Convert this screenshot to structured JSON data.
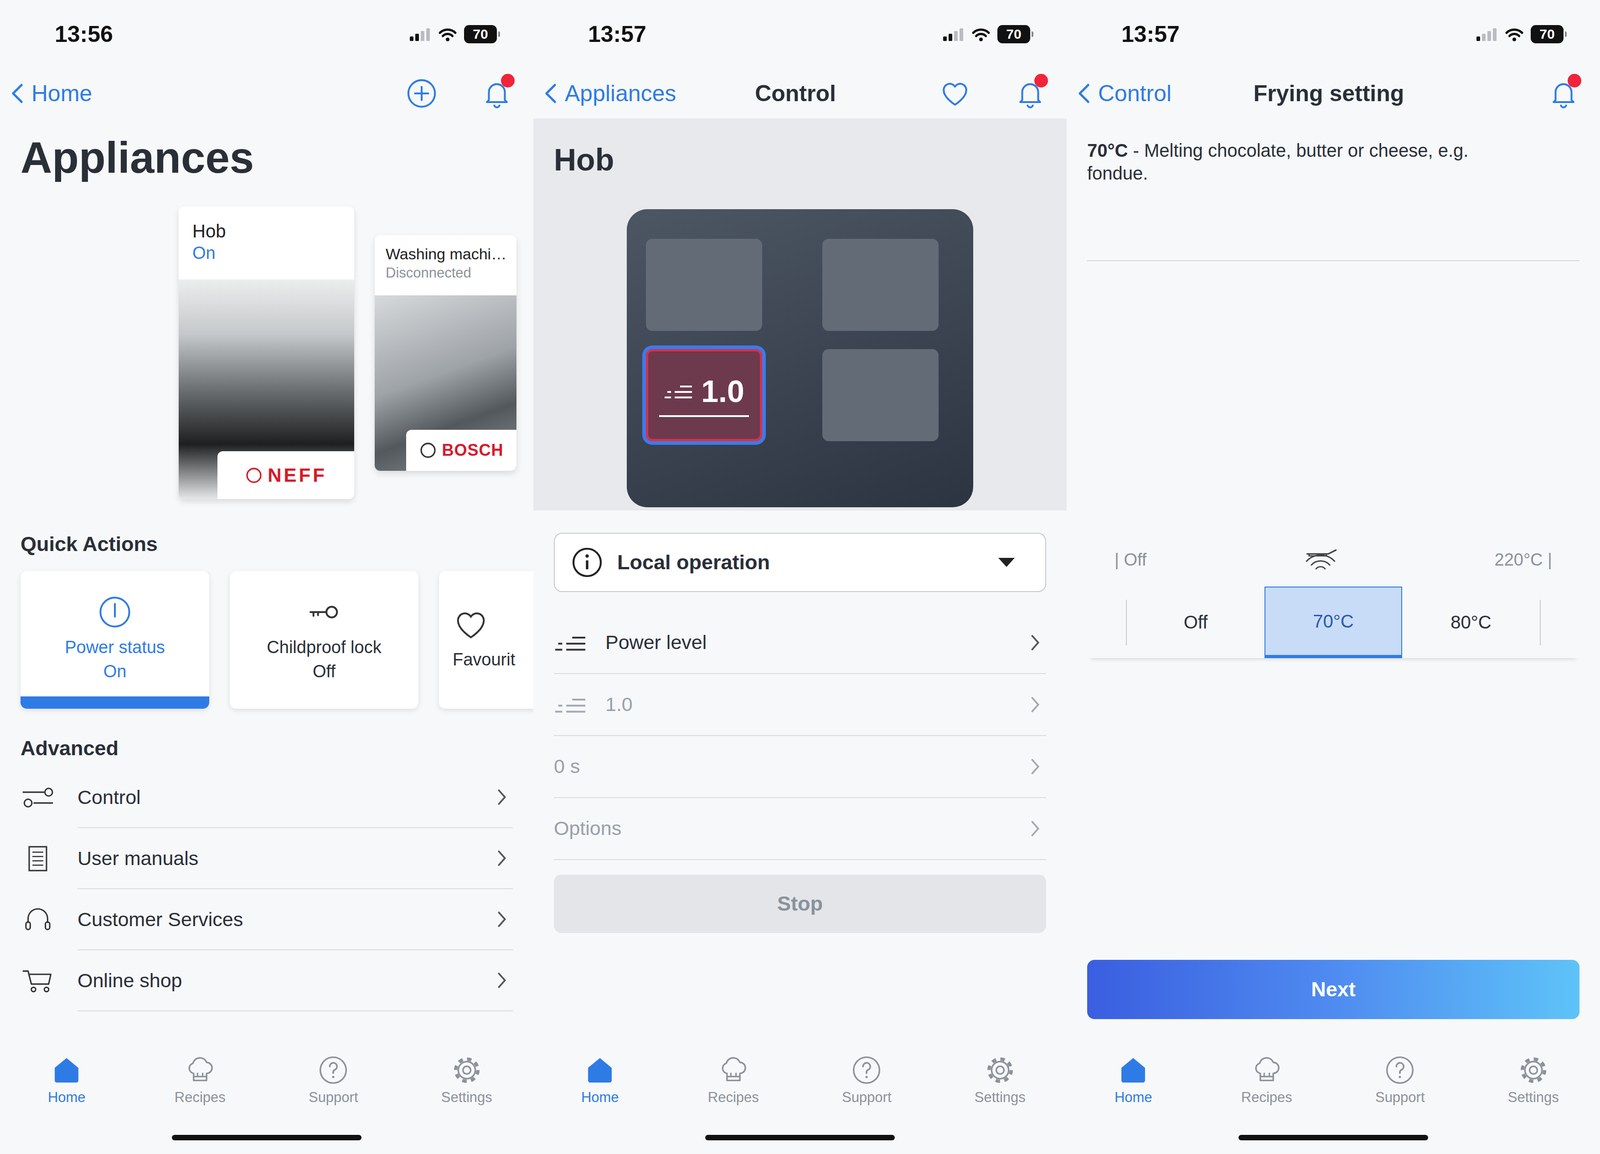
{
  "tab_bar": [
    {
      "label": "Home",
      "selected": true
    },
    {
      "label": "Recipes",
      "selected": false
    },
    {
      "label": "Support",
      "selected": false
    },
    {
      "label": "Settings",
      "selected": false
    }
  ],
  "screens": [
    {
      "kind": "appliances",
      "status_bar": {
        "time": "13:56",
        "battery": "70",
        "signal_bars": 2
      },
      "nav": {
        "back": "Home",
        "title": "",
        "notification": true
      },
      "title": "Appliances",
      "appliances": [
        {
          "name": "Hob",
          "status": "On",
          "brand": "NEFF",
          "connected": true,
          "selected": true
        },
        {
          "name": "Washing machi…",
          "status": "Disconnected",
          "brand": "BOSCH",
          "connected": false,
          "selected": false
        }
      ],
      "quick_actions": {
        "title": "Quick Actions",
        "items": [
          {
            "label": "Power status",
            "value": "On",
            "selected": true
          },
          {
            "label": "Childproof lock",
            "value": "Off",
            "selected": false
          },
          {
            "label": "Favourit",
            "value": "",
            "selected": false
          }
        ]
      },
      "advanced": {
        "title": "Advanced",
        "items": [
          "Control",
          "User manuals",
          "Customer Services",
          "Online shop"
        ]
      }
    },
    {
      "kind": "control",
      "status_bar": {
        "time": "13:57",
        "battery": "70",
        "signal_bars": 2
      },
      "nav": {
        "back": "Appliances",
        "title": "Control",
        "notification": true
      },
      "panel_title": "Hob",
      "zones": [
        {
          "selected": false,
          "level": ""
        },
        {
          "selected": false,
          "level": ""
        },
        {
          "selected": true,
          "level": "1.0"
        },
        {
          "selected": false,
          "level": ""
        }
      ],
      "dropdown": {
        "label": "Local operation",
        "expanded": false
      },
      "rows": [
        {
          "kind": "level",
          "label": "Power level",
          "disabled": false
        },
        {
          "kind": "level",
          "label": "1.0",
          "disabled": true
        },
        {
          "kind": "plain",
          "label": "0 s",
          "disabled": true
        },
        {
          "kind": "plain",
          "label": "Options",
          "disabled": true
        }
      ],
      "button": {
        "label": "Stop",
        "disabled": true
      }
    },
    {
      "kind": "frying",
      "status_bar": {
        "time": "13:57",
        "battery": "70",
        "signal_bars": 1
      },
      "nav": {
        "back": "Control",
        "title": "Frying setting",
        "notification": true
      },
      "description": {
        "value": "70°C",
        "text": " - Melting chocolate, butter or cheese, e.g. fondue."
      },
      "scale": {
        "min": "| Off",
        "max": "220°C |"
      },
      "options": [
        {
          "label": "Off",
          "selected": false
        },
        {
          "label": "70°C",
          "selected": true
        },
        {
          "label": "80°C",
          "selected": false
        }
      ],
      "button": {
        "label": "Next",
        "disabled": false
      }
    }
  ]
}
